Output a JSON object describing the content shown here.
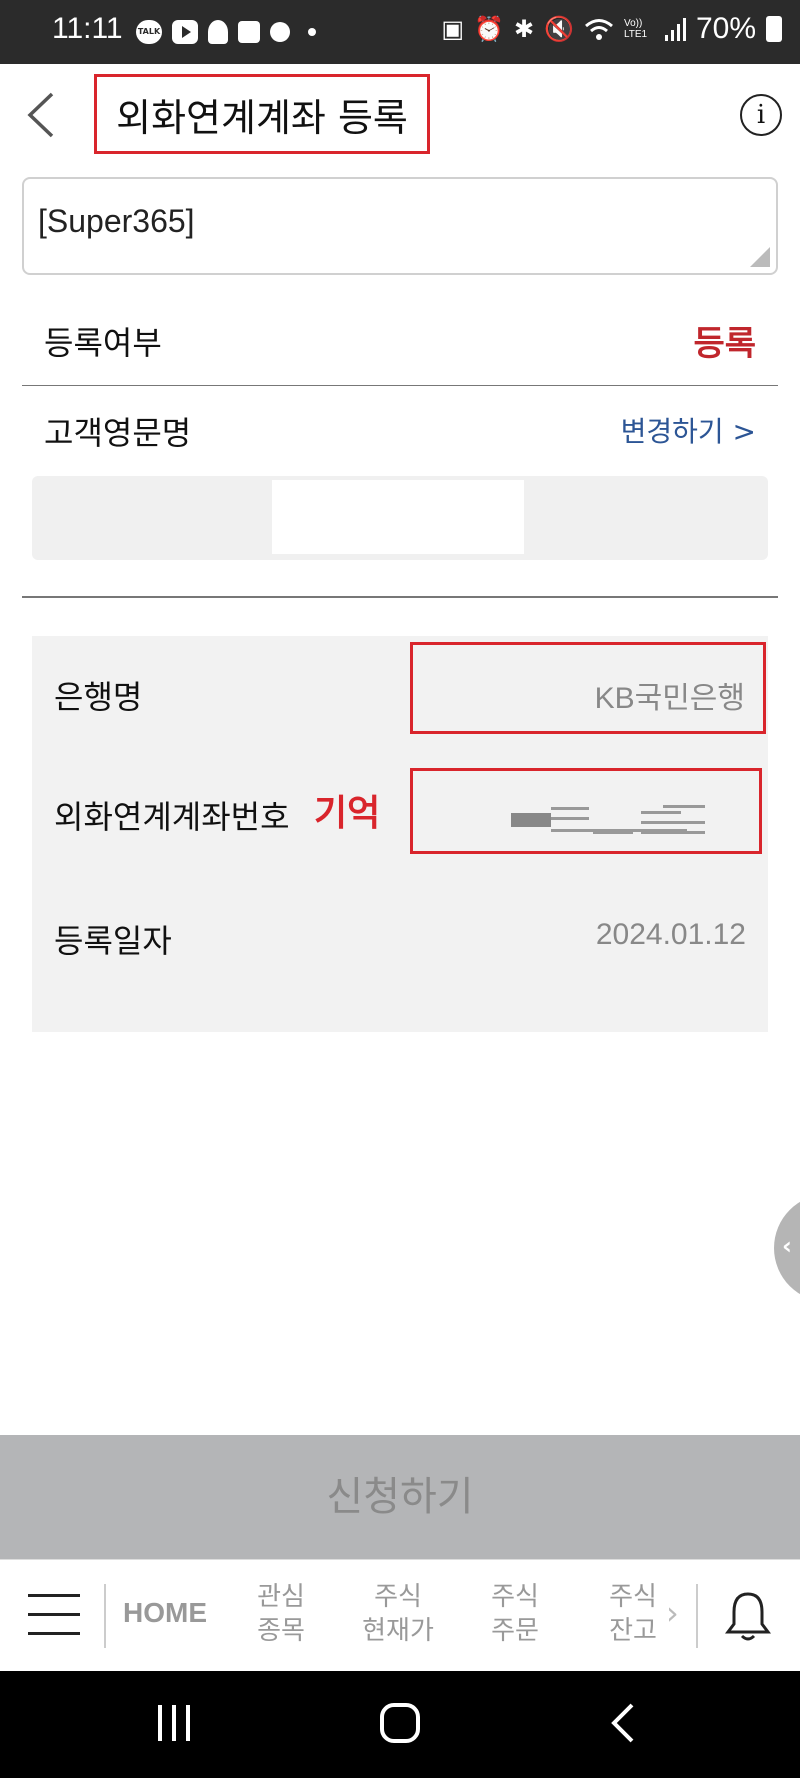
{
  "status_bar": {
    "time": "11:11",
    "battery_label": "70%",
    "left_icons": [
      "kakaotalk-icon",
      "youtube-icon",
      "app-icon",
      "check-icon",
      "app-icon",
      "dot-icon"
    ],
    "right_icons": [
      "photo-icon",
      "alarm-icon",
      "bluetooth-icon",
      "mute-icon",
      "wifi-icon",
      "volte-icon",
      "signal-icon",
      "battery-icon"
    ],
    "volte_label": "Vo)) LTE1"
  },
  "header": {
    "title": "외화연계계좌 등록",
    "back_icon": "chevron-left-icon",
    "info_icon": "info-icon",
    "info_glyph": "i"
  },
  "memo": {
    "value": "[Super365]"
  },
  "registration": {
    "label": "등록여부",
    "status": "등록",
    "status_color": "#c0262c"
  },
  "english_name": {
    "label": "고객영문명",
    "change_link": "변경하기 >",
    "value": ""
  },
  "account_info": {
    "bank_label": "은행명",
    "bank_value": "KB국민은행",
    "account_label": "외화연계계좌번호",
    "account_note": "기억",
    "date_label": "등록일자",
    "date_value": "2024.01.12"
  },
  "side_tab": {
    "glyph": "‹"
  },
  "apply_button": {
    "label": "신청하기"
  },
  "bottom_nav": {
    "home": "HOME",
    "items": [
      {
        "line1": "관심",
        "line2": "종목"
      },
      {
        "line1": "주식",
        "line2": "현재가"
      },
      {
        "line1": "주식",
        "line2": "주문"
      },
      {
        "line1": "주식",
        "line2": "잔고"
      }
    ],
    "more_glyph": "›"
  },
  "colors": {
    "accent_red": "#d9252c",
    "link_blue": "#2c5595",
    "button_gray": "#b4b5b7"
  }
}
